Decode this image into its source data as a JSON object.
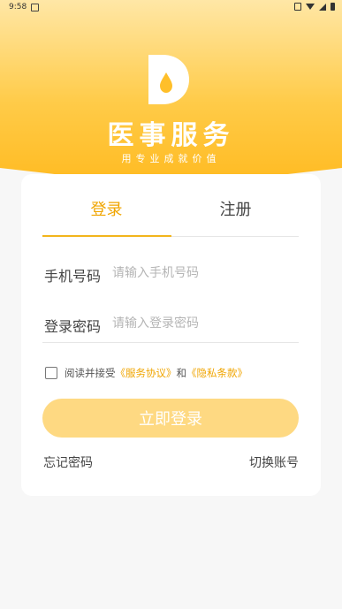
{
  "status_bar": {
    "time": "9:58"
  },
  "brand": {
    "app_name": "医事服务",
    "slogan": "用专业成就价值",
    "logo_icon": "d-drop-logo-icon",
    "colors": {
      "primary": "#ffbf2a",
      "accent_text": "#f0a500",
      "button": "#fed982"
    }
  },
  "tabs": {
    "login": "登录",
    "register": "注册",
    "active": "login"
  },
  "form": {
    "phone_label": "手机号码",
    "phone_placeholder": "请输入手机号码",
    "password_label": "登录密码",
    "password_placeholder": "请输入登录密码"
  },
  "agreement": {
    "prefix": "阅读并接受",
    "service": "《服务协议》",
    "and": "和",
    "privacy": "《隐私条款》",
    "checked": false
  },
  "buttons": {
    "login": "立即登录"
  },
  "links": {
    "forgot": "忘记密码",
    "switch_account": "切换账号"
  }
}
